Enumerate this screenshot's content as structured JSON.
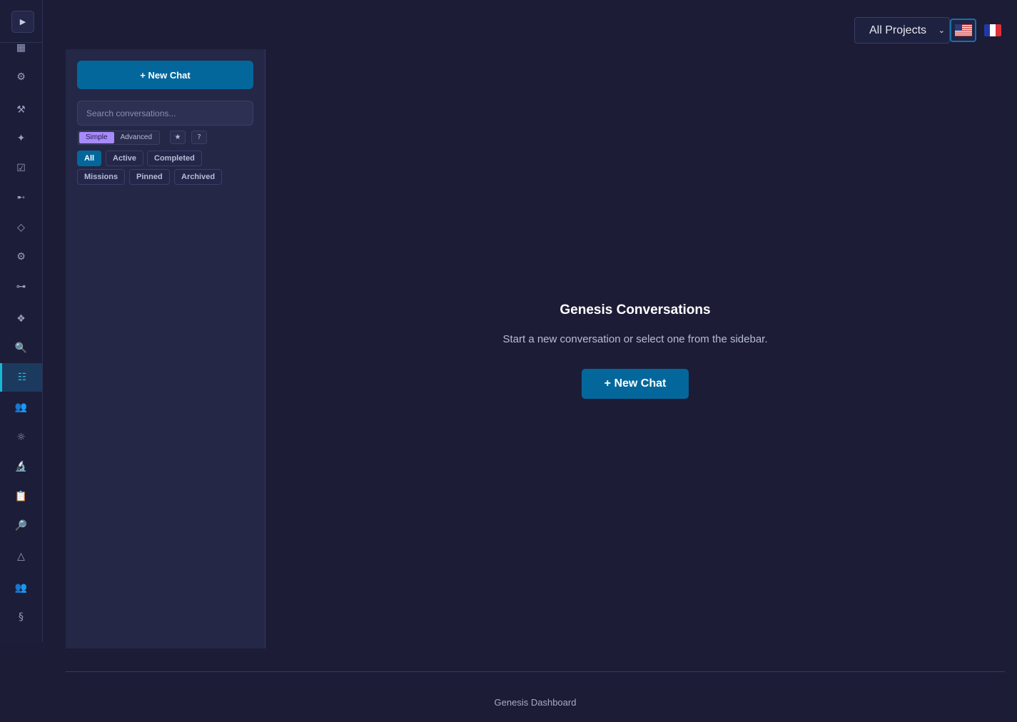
{
  "rail": {
    "toggle_icon": "▶",
    "items": [
      {
        "icon": "grid-icon",
        "glyph": "▦"
      },
      {
        "icon": "gear-icon",
        "glyph": "⚙"
      },
      {
        "icon": "tools-icon",
        "glyph": "⚒"
      },
      {
        "icon": "sparkle-icon",
        "glyph": "✦"
      },
      {
        "icon": "checkbox-icon",
        "glyph": "☑"
      },
      {
        "icon": "arrow-icon",
        "glyph": "➸"
      },
      {
        "icon": "diamond-outline-icon",
        "glyph": "◇"
      },
      {
        "icon": "settings-icon",
        "glyph": "⚙"
      },
      {
        "icon": "connector-icon",
        "glyph": "⊶"
      },
      {
        "icon": "diamond-icon",
        "glyph": "❖"
      },
      {
        "icon": "search-icon",
        "glyph": "🔍"
      },
      {
        "icon": "list-icon",
        "glyph": "☷"
      },
      {
        "icon": "people-icon",
        "glyph": "👥"
      },
      {
        "icon": "sun-icon",
        "glyph": "☼"
      },
      {
        "icon": "microscope-icon",
        "glyph": "🔬"
      },
      {
        "icon": "clipboard-icon",
        "glyph": "📋"
      },
      {
        "icon": "magnifier-icon",
        "glyph": "🔎"
      },
      {
        "icon": "triangle-icon",
        "glyph": "△"
      },
      {
        "icon": "group-icon",
        "glyph": "👥"
      },
      {
        "icon": "section-icon",
        "glyph": "§"
      }
    ],
    "active_index": 11
  },
  "sidebar": {
    "new_chat_label": "+ New Chat",
    "search_placeholder": "Search conversations...",
    "modes": [
      "Simple",
      "Advanced"
    ],
    "active_mode": "Simple",
    "star_label": "★",
    "help_label": "?",
    "filters_row1": [
      "All",
      "Active",
      "Completed"
    ],
    "filters_row2": [
      "Missions",
      "Pinned",
      "Archived"
    ],
    "active_filter": "All"
  },
  "header": {
    "project_select_value": "All Projects",
    "languages": [
      "en",
      "fr"
    ],
    "active_language": "en"
  },
  "main": {
    "title": "Genesis Conversations",
    "subtitle": "Start a new conversation or select one from the sidebar.",
    "new_chat_label": "+ New Chat"
  },
  "footer": {
    "text": "Genesis Dashboard"
  },
  "colors": {
    "background": "#1c1c36",
    "panel": "#242746",
    "accent": "#04679c",
    "mode_active": "#a78bfa",
    "rail_active": "#19b7d6"
  }
}
